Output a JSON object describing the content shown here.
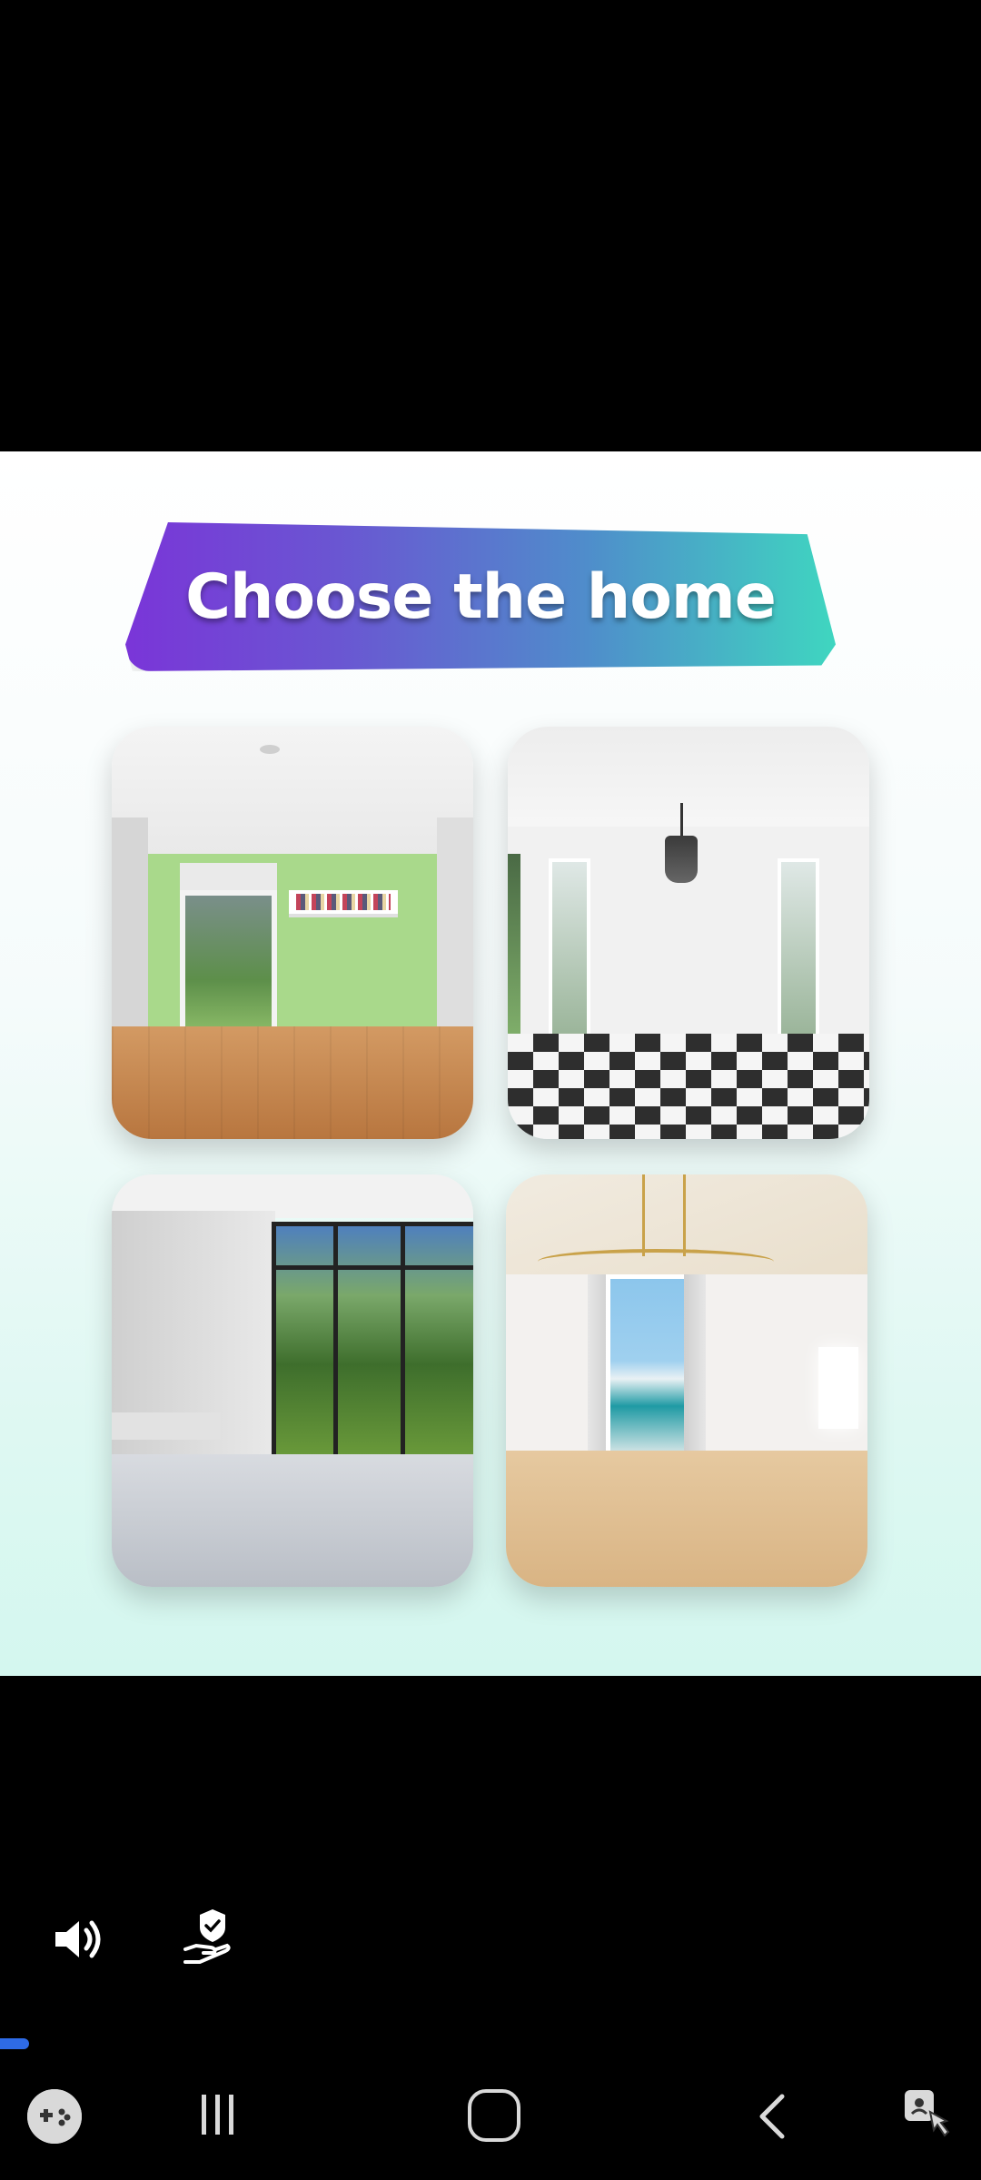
{
  "ad": {
    "title": "Choose the home",
    "options": [
      {
        "name": "green-wall-room"
      },
      {
        "name": "checkered-floor-room"
      },
      {
        "name": "tall-window-room"
      },
      {
        "name": "chandelier-room"
      }
    ]
  },
  "controls": {
    "sound_icon": "speaker-icon",
    "privacy_icon": "privacy-hand-shield-icon",
    "progress_value": 0.03,
    "progress_color": "#2e6be6"
  },
  "system_nav": {
    "items": [
      "game-launcher-icon",
      "recents-icon",
      "home-icon",
      "back-icon",
      "accessibility-icon"
    ]
  },
  "colors": {
    "banner_start": "#7a35d8",
    "banner_end": "#3fd6c0",
    "panel_bottom": "#d4f7ef"
  }
}
